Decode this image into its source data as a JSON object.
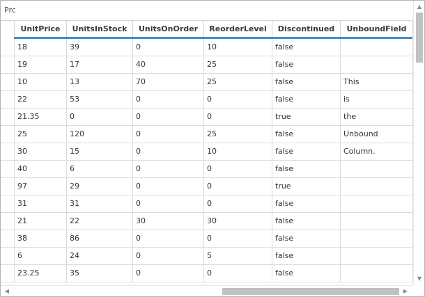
{
  "group_panel": {
    "prompt": "Prc"
  },
  "columns": [
    "UnitPrice",
    "UnitsInStock",
    "UnitsOnOrder",
    "ReorderLevel",
    "Discontinued",
    "UnboundField"
  ],
  "rows": [
    [
      "18",
      "39",
      "0",
      "10",
      "false",
      ""
    ],
    [
      "19",
      "17",
      "40",
      "25",
      "false",
      ""
    ],
    [
      "10",
      "13",
      "70",
      "25",
      "false",
      "This"
    ],
    [
      "22",
      "53",
      "0",
      "0",
      "false",
      "is"
    ],
    [
      "21.35",
      "0",
      "0",
      "0",
      "true",
      "the"
    ],
    [
      "25",
      "120",
      "0",
      "25",
      "false",
      "Unbound"
    ],
    [
      "30",
      "15",
      "0",
      "10",
      "false",
      "Column."
    ],
    [
      "40",
      "6",
      "0",
      "0",
      "false",
      ""
    ],
    [
      "97",
      "29",
      "0",
      "0",
      "true",
      ""
    ],
    [
      "31",
      "31",
      "0",
      "0",
      "false",
      ""
    ],
    [
      "21",
      "22",
      "30",
      "30",
      "false",
      ""
    ],
    [
      "38",
      "86",
      "0",
      "0",
      "false",
      ""
    ],
    [
      "6",
      "24",
      "0",
      "5",
      "false",
      ""
    ],
    [
      "23.25",
      "35",
      "0",
      "0",
      "false",
      ""
    ]
  ],
  "scrollbars": {
    "up_icon": "▲",
    "down_icon": "▼",
    "left_icon": "◀",
    "right_icon": "▶",
    "vertical_position": 0,
    "horizontal_position": 1
  },
  "colors": {
    "header_underline": "#3f8fcb"
  }
}
